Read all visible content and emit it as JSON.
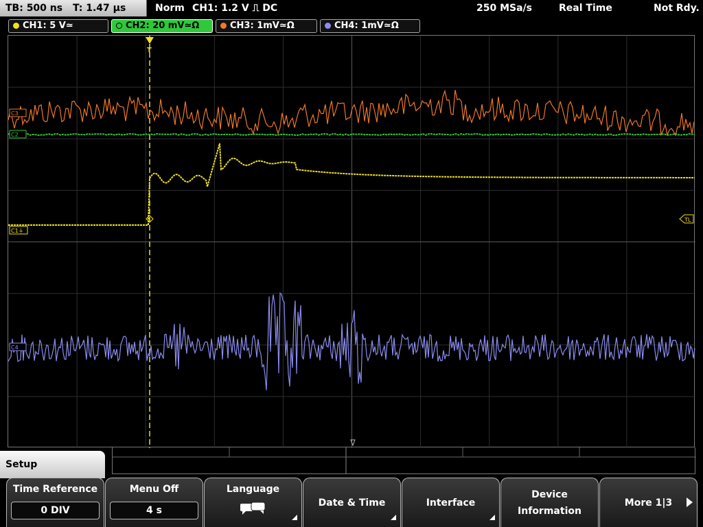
{
  "topbar": {
    "tb": "TB: 500 ns",
    "t": "T: 1.47 µs",
    "mode": "Norm",
    "trigger": "CH1: 1.2 V ⎍ DC",
    "rate": "250 MSa/s",
    "acq": "Real Time",
    "status": "Not Rdy."
  },
  "channels": [
    {
      "label": "CH1: 5 V≃",
      "color": "#f0e020"
    },
    {
      "label": "CH2: 20 mV≃Ω",
      "color": "#2ec83a"
    },
    {
      "label": "CH3: 1mV≃Ω",
      "color": "#f07828"
    },
    {
      "label": "CH4: 1mV≃Ω",
      "color": "#8c8cf0"
    }
  ],
  "markers": {
    "trigger_pos": "T",
    "c1": "C1⏚",
    "c2": "C2",
    "c3": "C3",
    "c4": "C4",
    "tl": "TL"
  },
  "setup_tab": "Setup",
  "softkeys": {
    "time_reference": {
      "label": "Time Reference",
      "value": "0 DIV"
    },
    "menu_off": {
      "label": "Menu Off",
      "value": "4 s"
    },
    "language": {
      "label": "Language",
      "icon": "speech-bubble-icon"
    },
    "date_time": {
      "label": "Date & Time"
    },
    "interface": {
      "label": "Interface"
    },
    "device_info": {
      "label1": "Device",
      "label2": "Information"
    },
    "more": {
      "label": "More 1|3"
    }
  }
}
